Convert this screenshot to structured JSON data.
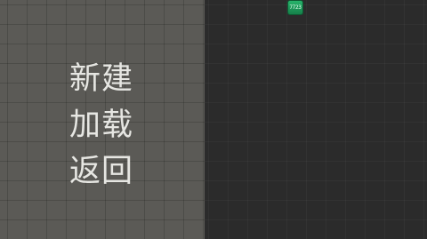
{
  "menu": {
    "items": [
      {
        "label": "新建"
      },
      {
        "label": "加载"
      },
      {
        "label": "返回"
      }
    ]
  },
  "badge": {
    "text": "7723",
    "color": "#1e9e5b"
  },
  "colors": {
    "left_panel": "#5b5a56",
    "right_panel": "#2b2b2b",
    "menu_text": "#e6e6e2"
  }
}
